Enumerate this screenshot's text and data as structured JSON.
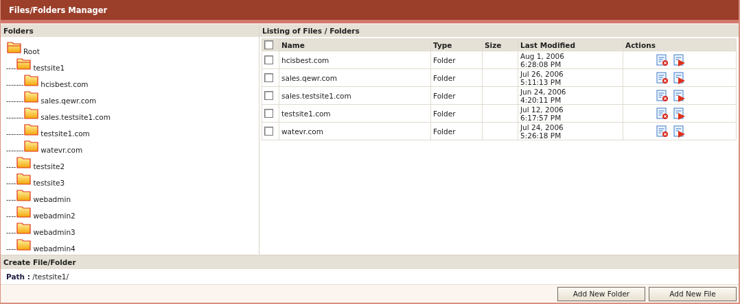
{
  "window": {
    "title": "Files/Folders Manager"
  },
  "folders_panel": {
    "title": "Folders",
    "tree": [
      {
        "name": "Root",
        "children": [
          {
            "name": "testsite1",
            "prefix": "----",
            "children": [
              {
                "name": "hcisbest.com",
                "prefix": "-------"
              },
              {
                "name": "sales.qewr.com",
                "prefix": "-------"
              },
              {
                "name": "sales.testsite1.com",
                "prefix": "-------"
              },
              {
                "name": "testsite1.com",
                "prefix": "-------"
              },
              {
                "name": "watevr.com",
                "prefix": "-------"
              }
            ]
          },
          {
            "name": "testsite2",
            "prefix": "----"
          },
          {
            "name": "testsite3",
            "prefix": "----"
          },
          {
            "name": "webadmin",
            "prefix": "----"
          },
          {
            "name": "webadmin2",
            "prefix": "----"
          },
          {
            "name": "webadmin3",
            "prefix": "----"
          },
          {
            "name": "webadmin4",
            "prefix": "----"
          }
        ]
      }
    ]
  },
  "listing": {
    "title": "Listing of Files / Folders",
    "select_all_checked": false,
    "columns": [
      "Name",
      "Type",
      "Size",
      "Last Modified",
      "Actions"
    ],
    "rows": [
      {
        "checked": false,
        "name": "hcisbest.com",
        "type": "Folder",
        "date": "Aug 1, 2006",
        "time": "6:28:08 PM"
      },
      {
        "checked": false,
        "name": "sales.qewr.com",
        "type": "Folder",
        "date": "Jul 26, 2006",
        "time": "5:11:13 PM"
      },
      {
        "checked": false,
        "name": "sales.testsite1.com",
        "type": "Folder",
        "date": "Jun 24, 2006",
        "time": "4:20:11 PM"
      },
      {
        "checked": false,
        "name": "testsite1.com",
        "type": "Folder",
        "date": "Jul 12, 2006",
        "time": "6:17:57 PM"
      },
      {
        "checked": false,
        "name": "watevr.com",
        "type": "Folder",
        "date": "Jul 24, 2006",
        "time": "5:26:18 PM"
      }
    ]
  },
  "create": {
    "title": "Create File/Folder",
    "path_label": "Path :",
    "path": "/testsite1/",
    "buttons": [
      "Add New Folder",
      "Add New File"
    ]
  }
}
